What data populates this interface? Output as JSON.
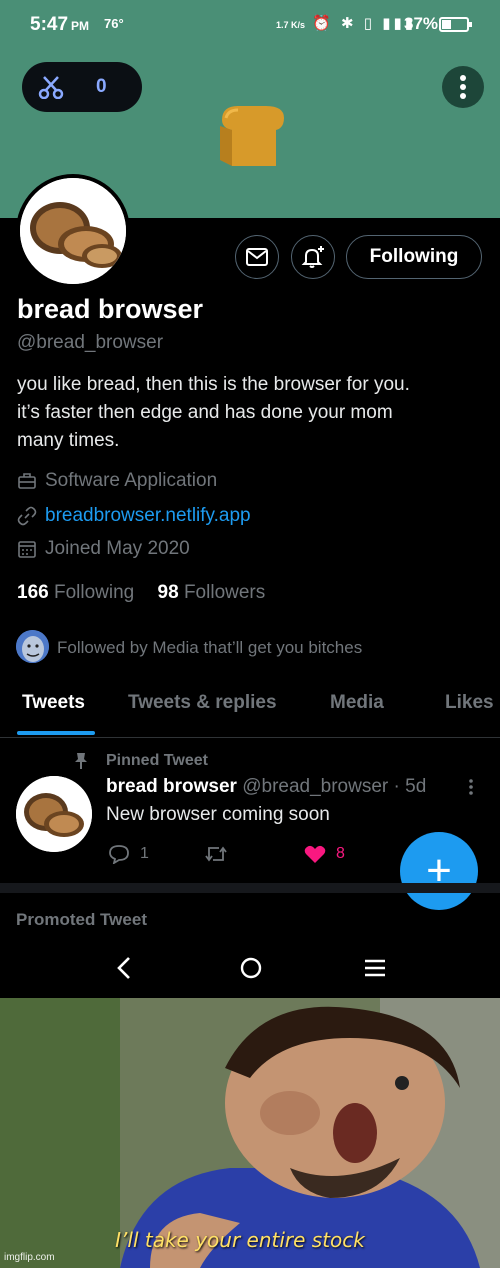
{
  "status_bar": {
    "time": "5:47",
    "ampm": "PM",
    "temperature": "76°",
    "network_speed": "1.7 K/s",
    "battery": "37%"
  },
  "banner": {
    "counter": "0"
  },
  "profile": {
    "name": "bread browser",
    "handle": "@bread_browser",
    "bio_lines": [
      "you like bread, then this is the browser for you.",
      "it’s faster then edge and has done your mom",
      "many times."
    ],
    "category": "Software Application",
    "website": "breadbrowser.netlify.app",
    "joined": "Joined May 2020",
    "following_count": "166",
    "following_label": "Following",
    "followers_count": "98",
    "followers_label": "Followers",
    "followed_by": "Followed by Media that’ll get you bitches",
    "follow_button": "Following"
  },
  "tabs": [
    "Tweets",
    "Tweets & replies",
    "Media",
    "Likes"
  ],
  "pinned_tweet": {
    "label": "Pinned Tweet",
    "author": "bread browser",
    "handle_time": "@bread_browser · 5d",
    "text": "New browser coming soon",
    "replies": "1",
    "likes": "8"
  },
  "promoted_label": "Promoted Tweet",
  "meme": {
    "caption": "I’ll take your entire stock",
    "watermark": "imgflip.com"
  },
  "colors": {
    "banner": "#4a8f76",
    "accent": "#1d9bf0",
    "like": "#f91880"
  }
}
